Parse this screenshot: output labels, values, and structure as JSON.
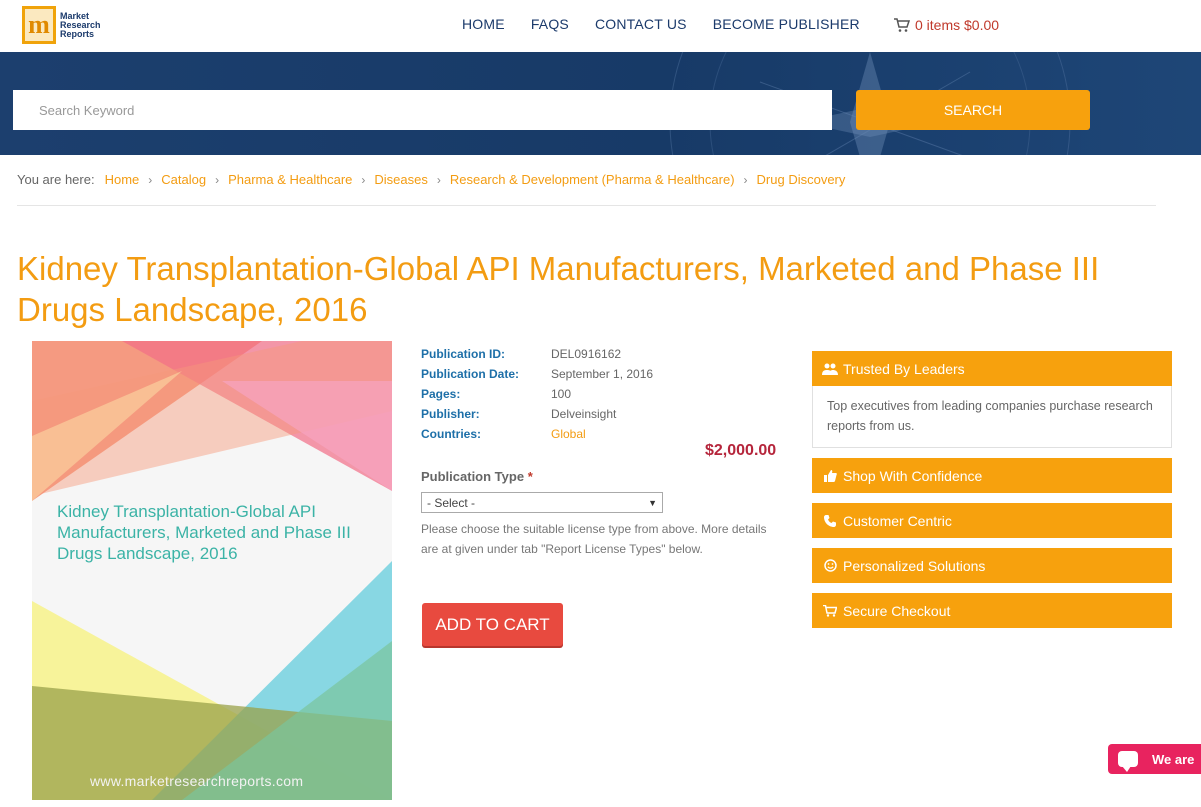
{
  "brand": {
    "logo_letter": "m",
    "logo_lines": [
      "Market",
      "Research",
      "Reports"
    ]
  },
  "nav": {
    "items": [
      "HOME",
      "FAQS",
      "CONTACT US",
      "BECOME PUBLISHER"
    ],
    "cart": "0 items $0.00"
  },
  "search": {
    "placeholder": "Search Keyword",
    "button": "SEARCH"
  },
  "breadcrumb": {
    "prefix": "You are here:",
    "items": [
      "Home",
      "Catalog",
      "Pharma & Healthcare",
      "Diseases",
      "Research & Development (Pharma & Healthcare)",
      "Drug Discovery"
    ]
  },
  "product": {
    "title": "Kidney Transplantation-Global API Manufacturers, Marketed and Phase III Drugs Landscape, 2016",
    "cover_title": "Kidney Transplantation-Global API Manufacturers, Marketed and Phase III Drugs Landscape, 2016",
    "cover_url": "www.marketresearchreports.com",
    "details": [
      {
        "label": "Publication ID:",
        "value": "DEL0916162"
      },
      {
        "label": "Publication Date:",
        "value": "September 1, 2016"
      },
      {
        "label": "Pages:",
        "value": "100"
      },
      {
        "label": "Publisher:",
        "value": "Delveinsight"
      },
      {
        "label": "Countries:",
        "value": "Global"
      }
    ],
    "price": "$2,000.00",
    "pub_type_label": "Publication Type",
    "required_mark": "*",
    "select_value": "- Select -",
    "help_text": "Please choose the suitable license type from above. More details are at given under tab \"Report License Types\" below.",
    "add_to_cart": "ADD TO CART"
  },
  "side": {
    "trusted_title": "Trusted By Leaders",
    "trusted_body": "Top executives from leading companies purchase research reports from us.",
    "items": [
      "Shop With Confidence",
      "Customer Centric",
      "Personalized Solutions",
      "Secure Checkout"
    ]
  },
  "chat": {
    "label": "We are"
  },
  "colors": {
    "accent": "#f7a10d",
    "title": "#f39c12",
    "nav": "#1b3a6b",
    "banner": "#1c3f6e",
    "price": "#b5253b",
    "cart_button": "#e84a3f",
    "chat": "#e8235f"
  }
}
